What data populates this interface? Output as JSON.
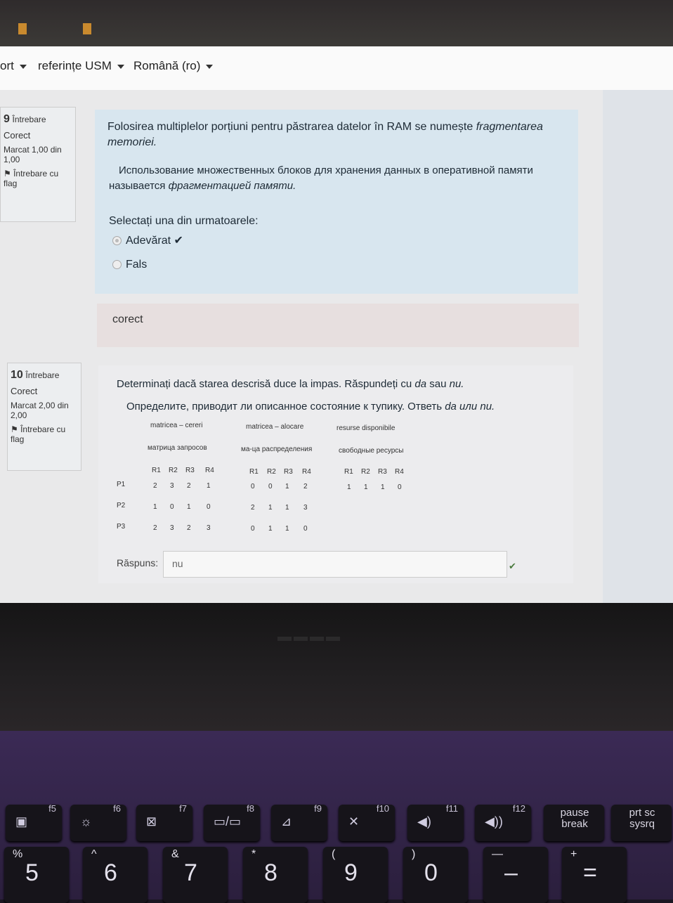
{
  "nav": {
    "items": [
      {
        "label": "ort"
      },
      {
        "label": "referințe USM"
      },
      {
        "label": "Română (ro)"
      }
    ]
  },
  "q9": {
    "number": "9",
    "word": "Întrebare",
    "state": "Corect",
    "mark": "Marcat 1,00 din 1,00",
    "flag": "Întrebare cu flag",
    "text_ro_1": "Folosirea multiplelor porțiuni pentru păstrarea datelor în RAM se numește ",
    "text_ro_em": "fragmentarea memoriei.",
    "text_ru_1": "Использование множественных блоков для хранения данных в оперативной памяти называется ",
    "text_ru_em": "фрагментацией памяти.",
    "prompt": "Selectați una din urmatoarele:",
    "options": [
      {
        "label": "Adevărat",
        "mark": "✔"
      },
      {
        "label": "Fals"
      }
    ],
    "feedback": "corect"
  },
  "q10": {
    "number": "10",
    "word": "Întrebare",
    "state": "Corect",
    "mark": "Marcat 2,00 din 2,00",
    "flag": "Întrebare cu flag",
    "text_ro_1": "Determinați dacă starea descrisă duce la impas. Răspundeți cu ",
    "text_ro_em1": "da",
    "text_ro_2": " sau ",
    "text_ro_em2": "nu.",
    "text_ru_1": "Определите, приводит ли описанное состояние к тупику. Ответь ",
    "text_ru_em": "da или nu.",
    "matrices": {
      "cereri_ro": "matricea – cereri",
      "cereri_ru": "матрица запросов",
      "alocare_ro": "matricea – alocare",
      "alocare_ru": "ма-ца распределения",
      "resurse_ro": "resurse disponibile",
      "resurse_ru": "свободные ресурсы",
      "cols": [
        "R1",
        "R2",
        "R3",
        "R4"
      ],
      "rows": [
        "P1",
        "P2",
        "P3"
      ],
      "cereri": [
        [
          "2",
          "3",
          "2",
          "1"
        ],
        [
          "1",
          "0",
          "1",
          "0"
        ],
        [
          "2",
          "3",
          "2",
          "3"
        ]
      ],
      "alocare": [
        [
          "0",
          "0",
          "1",
          "2"
        ],
        [
          "2",
          "1",
          "1",
          "3"
        ],
        [
          "0",
          "1",
          "1",
          "0"
        ]
      ],
      "disponibile": [
        "1",
        "1",
        "1",
        "0"
      ]
    },
    "answer_label": "Răspuns:",
    "answer_value": "nu",
    "answer_mark": "✔"
  },
  "keyboard": {
    "fkeys": [
      {
        "label": "f5",
        "icon": "▣"
      },
      {
        "label": "f6",
        "icon": "☼"
      },
      {
        "label": "f7",
        "icon": "⊠"
      },
      {
        "label": "f8",
        "icon": "▭/▭"
      },
      {
        "label": "f9",
        "icon": "⊿"
      },
      {
        "label": "f10",
        "icon": "✕"
      },
      {
        "label": "f11",
        "icon": "◀)"
      },
      {
        "label": "f12",
        "icon": "◀))"
      },
      {
        "label": "pause break",
        "icon": ""
      },
      {
        "label": "prt sc sysrq",
        "icon": ""
      }
    ],
    "numkeys": [
      {
        "top": "%",
        "main": "5"
      },
      {
        "top": "^",
        "main": "6"
      },
      {
        "top": "&",
        "main": "7"
      },
      {
        "top": "*",
        "main": "8"
      },
      {
        "top": "(",
        "main": "9"
      },
      {
        "top": ")",
        "main": "0"
      },
      {
        "top": "—",
        "main": "–"
      },
      {
        "top": "+",
        "main": "="
      }
    ]
  }
}
